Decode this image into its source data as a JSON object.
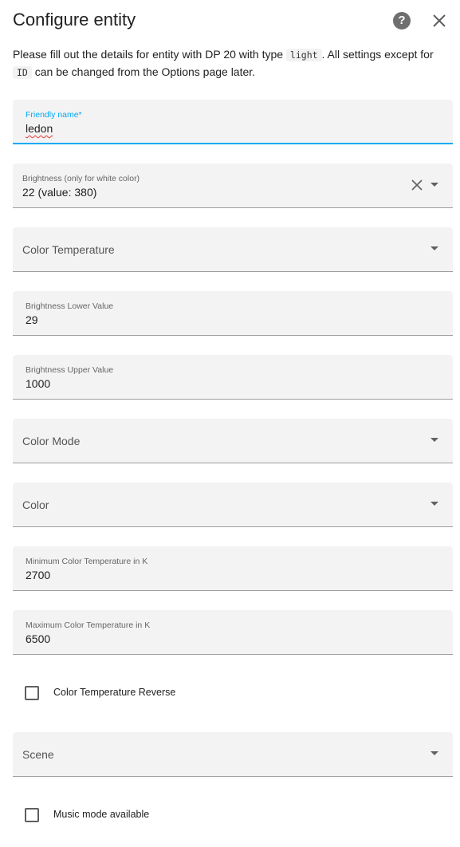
{
  "dialog": {
    "title": "Configure entity",
    "help_glyph": "?",
    "help_icon": "help-circle-icon",
    "close_icon": "close-icon"
  },
  "description": {
    "part1": "Please fill out the details for entity with DP 20 with type ",
    "code1": "light",
    "part2": ". All settings except for ",
    "code2": "ID",
    "part3": " can be changed from the Options page later."
  },
  "fields": {
    "friendly_name": {
      "label": "Friendly name*",
      "value": "ledon"
    },
    "brightness": {
      "label": "Brightness (only for white color)",
      "value": "22 (value: 380)"
    },
    "color_temp": {
      "placeholder": "Color Temperature"
    },
    "brightness_lower": {
      "label": "Brightness Lower Value",
      "value": "29"
    },
    "brightness_upper": {
      "label": "Brightness Upper Value",
      "value": "1000"
    },
    "color_mode": {
      "placeholder": "Color Mode"
    },
    "color": {
      "placeholder": "Color"
    },
    "min_color_temp": {
      "label": "Minimum Color Temperature in K",
      "value": "2700"
    },
    "max_color_temp": {
      "label": "Maximum Color Temperature in K",
      "value": "6500"
    },
    "scene": {
      "placeholder": "Scene"
    }
  },
  "checkboxes": {
    "color_temp_reverse": {
      "label": "Color Temperature Reverse",
      "checked": false
    },
    "music_mode": {
      "label": "Music mode available",
      "checked": false
    }
  },
  "colors": {
    "accent": "#03a9f4",
    "field_bg": "#f3f3f3",
    "error_underline": "#e53935"
  }
}
